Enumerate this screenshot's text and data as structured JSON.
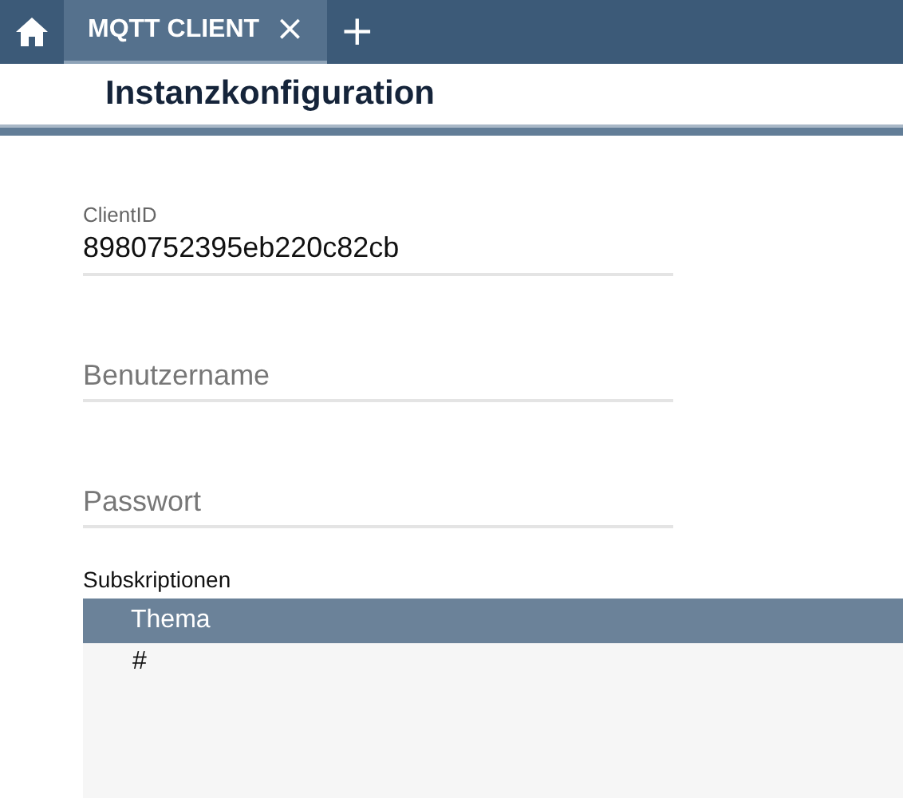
{
  "tabs": [
    {
      "label": "MQTT CLIENT",
      "close": "×",
      "selected": true
    }
  ],
  "add_tab": "+",
  "page_title": "Instanzkonfiguration",
  "fields": [
    {
      "label": "ClientID",
      "value": "8980752395eb220c82cb"
    },
    {
      "placeholder": "Benutzername"
    },
    {
      "placeholder": "Passwort"
    }
  ],
  "subscriptions": {
    "title": "Subskriptionen",
    "columns": [
      "Thema"
    ],
    "rows": [
      [
        "#"
      ]
    ]
  }
}
